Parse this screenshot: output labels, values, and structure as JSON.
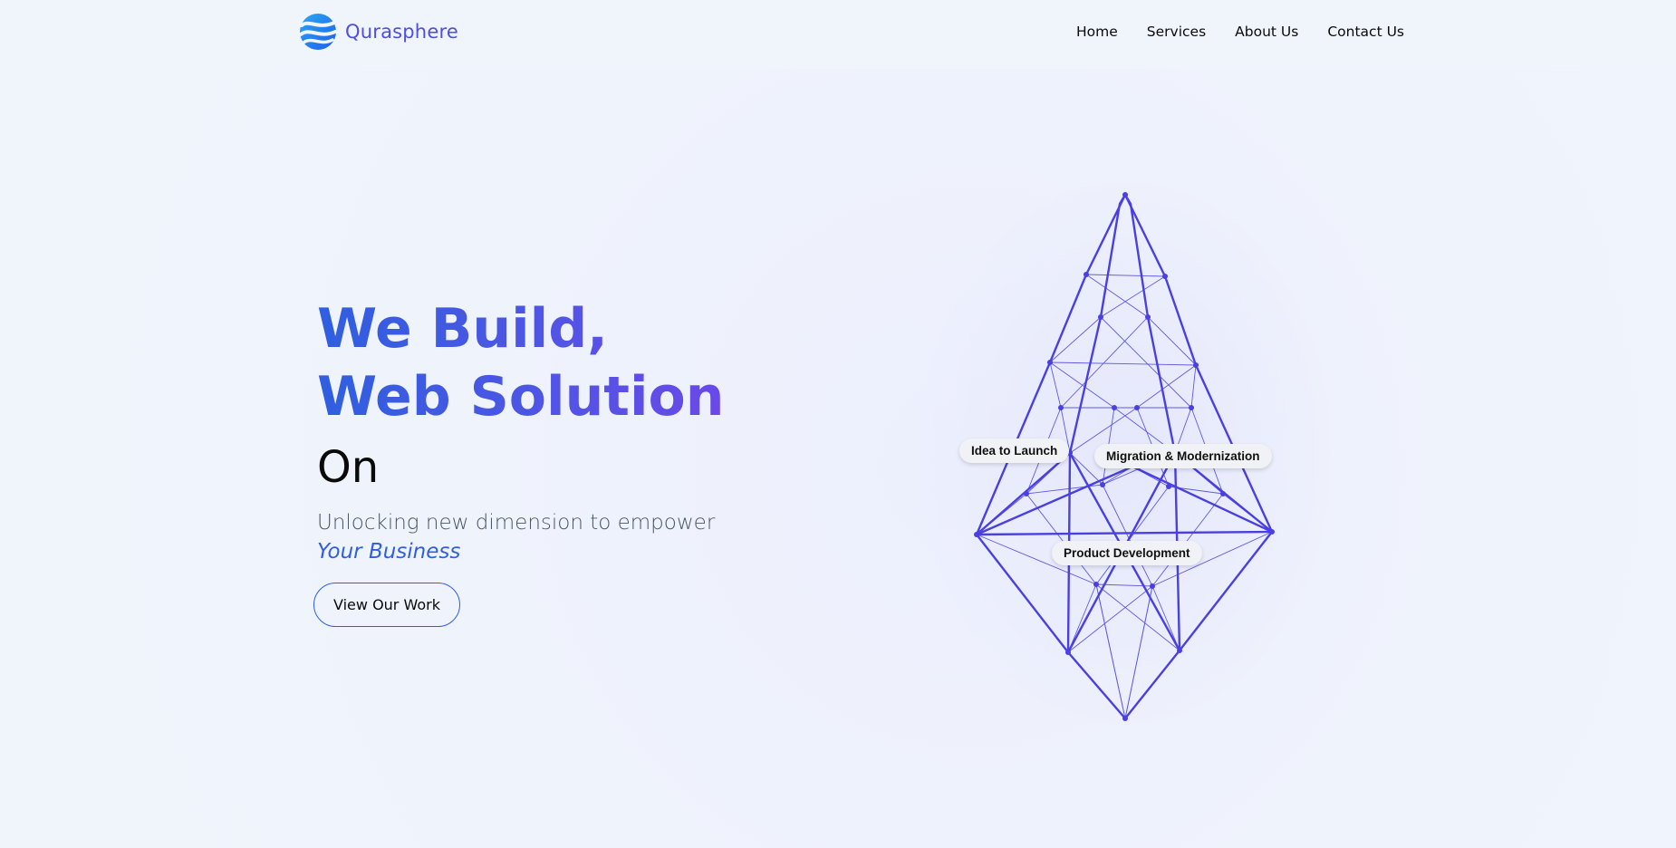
{
  "brand": {
    "name": "Qurasphere",
    "logo_icon": "wave-globe-icon",
    "color": "#4f4ee0"
  },
  "nav": {
    "items": [
      {
        "label": "Home"
      },
      {
        "label": "Services"
      },
      {
        "label": "About Us"
      },
      {
        "label": "Contact Us"
      }
    ]
  },
  "hero": {
    "title_line1": "We Build,",
    "title_line2": "Web Solution",
    "title_line3": "On",
    "subtitle": "Unlocking new dimension to empower",
    "emphasis": "Your Business",
    "cta_label": "View Our Work",
    "accent": "#2f5fe0"
  },
  "illustration": {
    "icon": "wireframe-diamond-icon",
    "stroke_color": "#4a3fe0",
    "labels": [
      "Idea to Launch",
      "Migration & Modernization",
      "Product Development"
    ]
  }
}
